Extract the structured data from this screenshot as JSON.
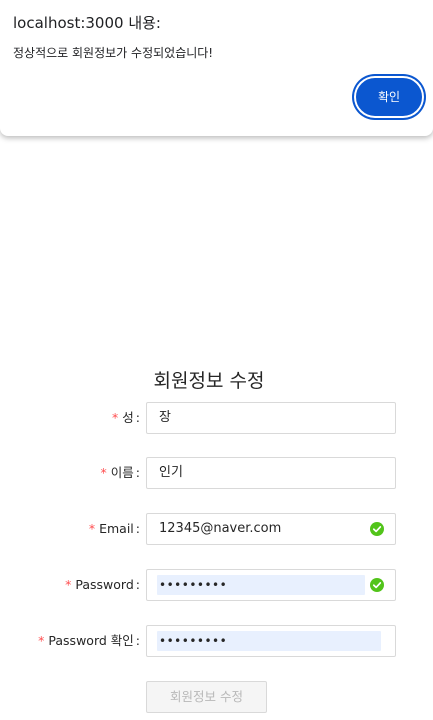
{
  "alert": {
    "title": "localhost:3000 내용:",
    "message": "정상적으로 회원정보가 수정되었습니다!",
    "ok_label": "확인",
    "accent_color": "#0b57d0"
  },
  "form": {
    "title": "회원정보 수정",
    "required_marker": "*",
    "required_color": "#ff4d4f",
    "success_color": "#52c41a",
    "fields": [
      {
        "label": "성",
        "value": "장"
      },
      {
        "label": "이름",
        "value": "인기"
      },
      {
        "label": "Email",
        "value": "12345@naver.com",
        "status_icon": "check-circle-icon"
      },
      {
        "label": "Password",
        "value": "•••••••••",
        "status_icon": "check-circle-icon"
      },
      {
        "label": "Password 확인",
        "value": "•••••••••"
      }
    ],
    "submit_label": "회원정보 수정"
  }
}
